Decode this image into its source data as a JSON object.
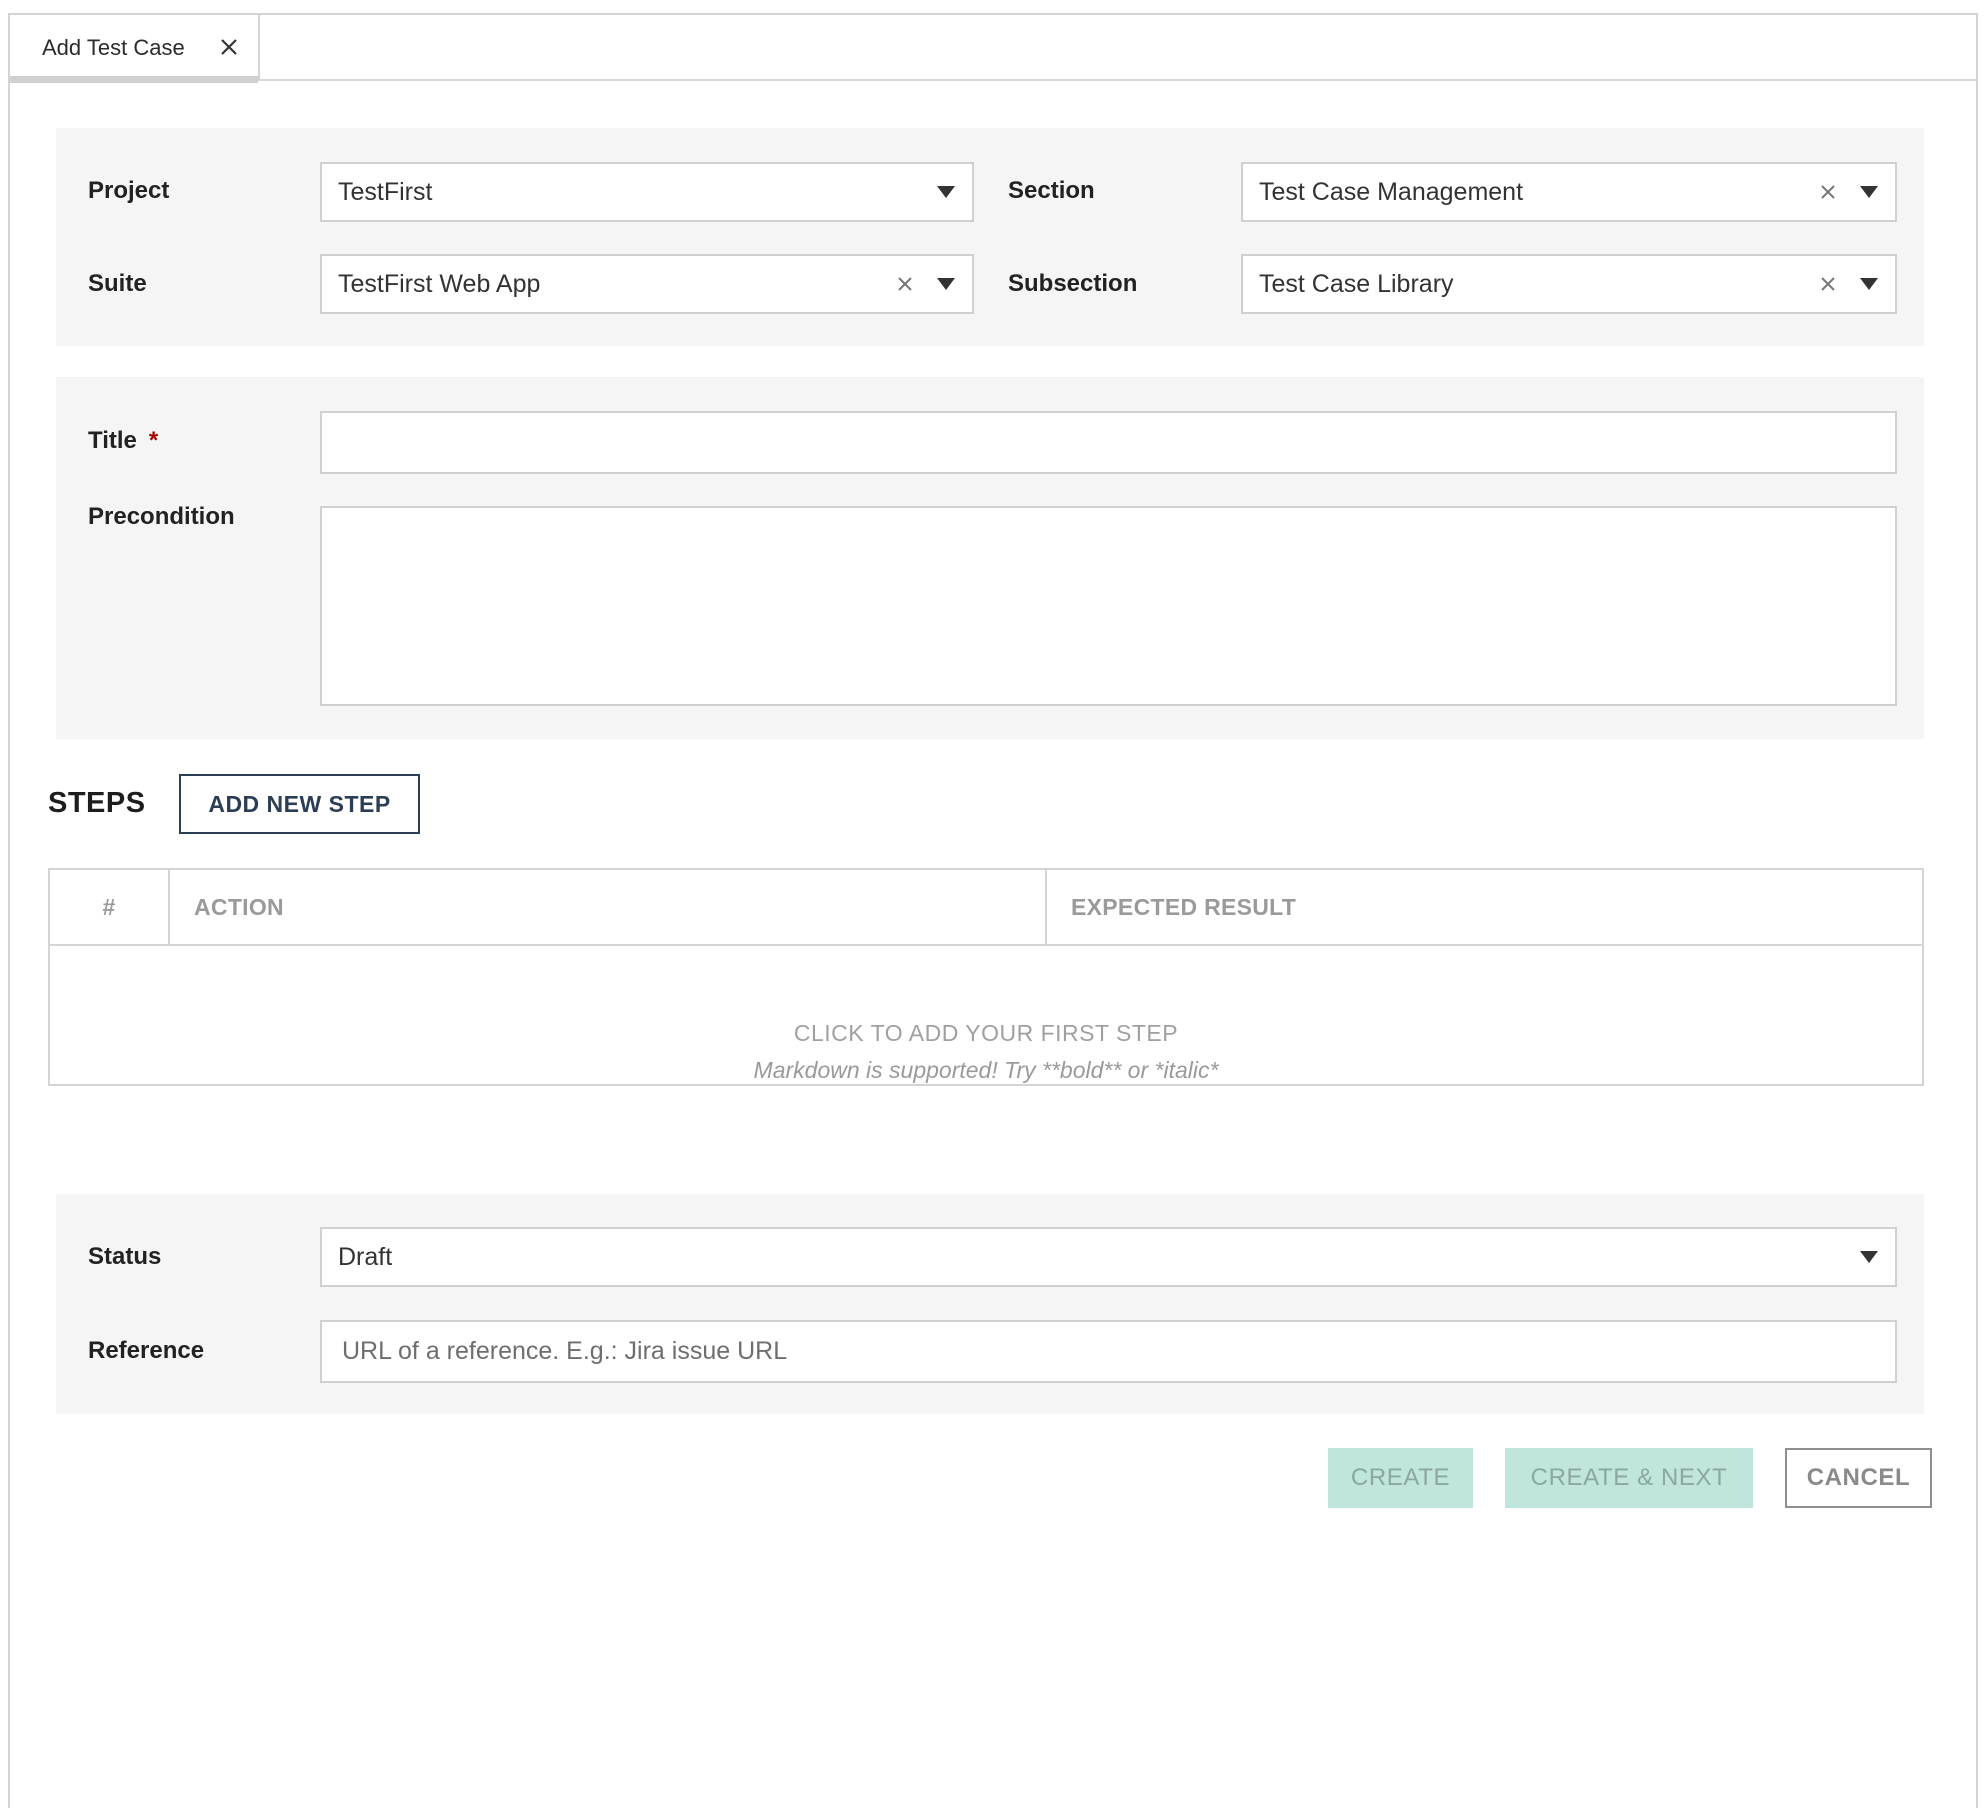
{
  "tab": {
    "label": "Add Test Case"
  },
  "meta": {
    "project": {
      "label": "Project",
      "value": "TestFirst"
    },
    "suite": {
      "label": "Suite",
      "value": "TestFirst Web App"
    },
    "section": {
      "label": "Section",
      "value": "Test Case Management"
    },
    "subsection": {
      "label": "Subsection",
      "value": "Test Case Library"
    }
  },
  "details": {
    "title": {
      "label": "Title",
      "required_marker": "*",
      "value": ""
    },
    "precondition": {
      "label": "Precondition",
      "value": ""
    }
  },
  "steps": {
    "heading": "STEPS",
    "add_button": "ADD NEW STEP",
    "columns": {
      "number": "#",
      "action": "ACTION",
      "expected": "EXPECTED RESULT"
    },
    "empty_title": "CLICK TO ADD YOUR FIRST STEP",
    "empty_hint": "Markdown is supported! Try **bold** or *italic*"
  },
  "extra": {
    "status": {
      "label": "Status",
      "value": "Draft"
    },
    "reference": {
      "label": "Reference",
      "placeholder": "URL of a reference. E.g.: Jira issue URL",
      "value": ""
    }
  },
  "actions": {
    "create": "CREATE",
    "create_next": "CREATE & NEXT",
    "cancel": "CANCEL"
  },
  "colors": {
    "accent_disabled": "#bfe5dc",
    "dark_button": "#2c3e55",
    "required": "#a40000",
    "panel_bg": "#f5f5f5"
  }
}
